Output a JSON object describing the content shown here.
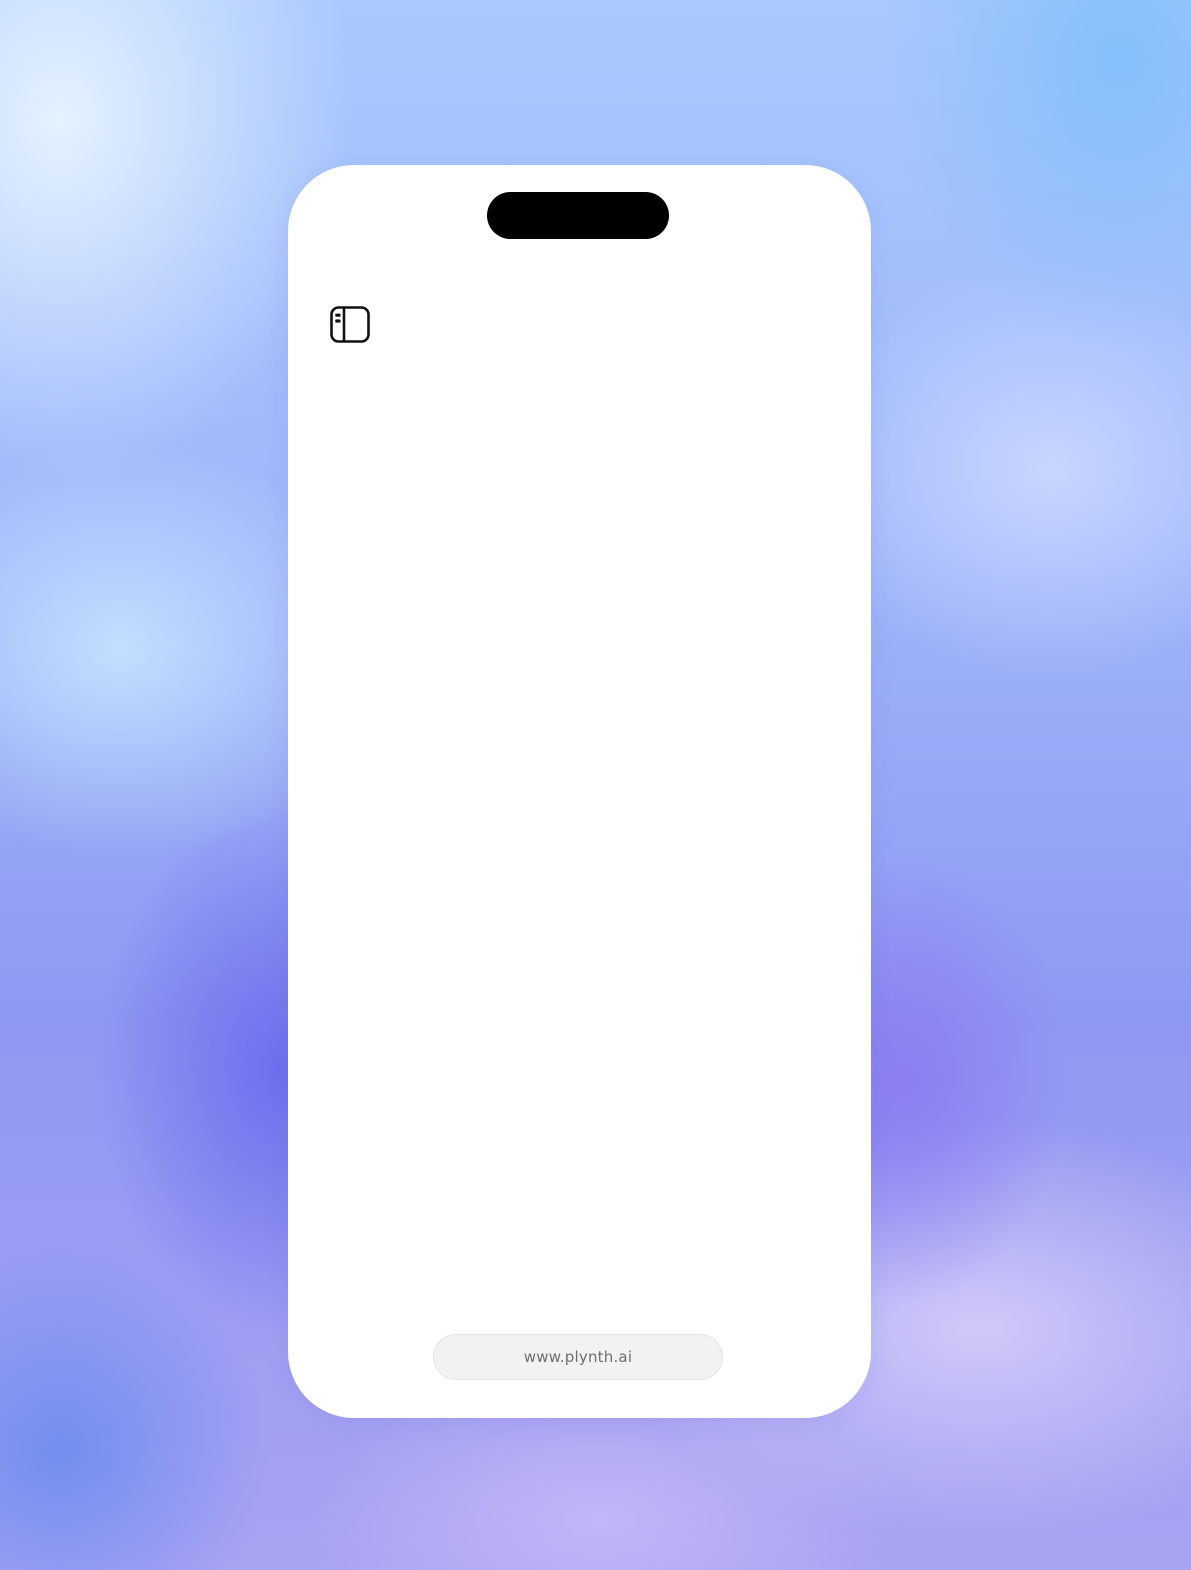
{
  "icons": {
    "sidebar_toggle": "sidebar-toggle-icon"
  },
  "address_bar": {
    "url": "www.plynth.ai"
  },
  "colors": {
    "screen_background": "#ffffff",
    "island": "#000000",
    "url_pill_background": "#f2f2f2",
    "url_text": "#6e6e6e",
    "icon_stroke": "#111111"
  }
}
